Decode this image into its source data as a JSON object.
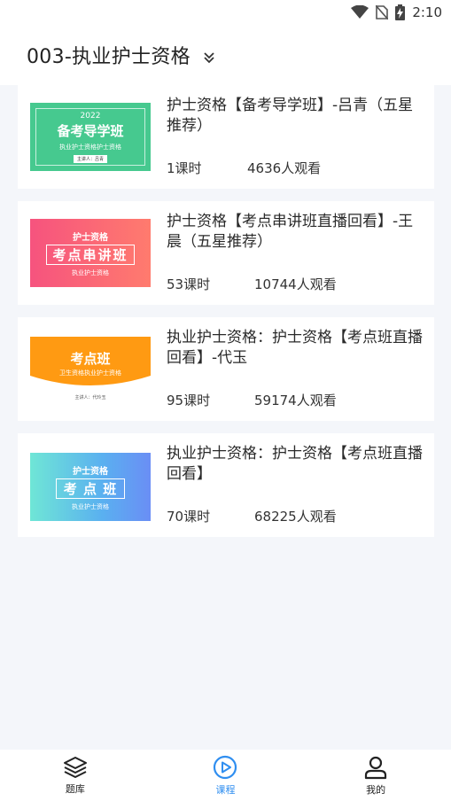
{
  "status": {
    "time": "2:10"
  },
  "header": {
    "title": "003-执业护士资格"
  },
  "courses": [
    {
      "title": "护士资格【备考导学班】-吕青（五星推荐）",
      "lessons": "1课时",
      "views": "4636人观看",
      "thumb": {
        "year": "2022",
        "main": "备考导学班",
        "sub": "执业护士资格护士资格",
        "lecturer": "主讲人：吕青"
      }
    },
    {
      "title": "护士资格【考点串讲班直播回看】-王晨（五星推荐）",
      "lessons": "53课时",
      "views": "10744人观看",
      "thumb": {
        "top": "护士资格",
        "main": "考点串讲班",
        "sub": "执业护士资格"
      }
    },
    {
      "title": "执业护士资格：护士资格【考点班直播回看】-代玉",
      "lessons": "95课时",
      "views": "59174人观看",
      "thumb": {
        "main": "考点班",
        "sub": "卫生资格执业护士资格",
        "lecturer": "主讲人：代玲玉"
      }
    },
    {
      "title": "执业护士资格：护士资格【考点班直播回看】",
      "lessons": "70课时",
      "views": "68225人观看",
      "thumb": {
        "top": "护士资格",
        "main": "考 点 班",
        "sub": "执业护士资格"
      }
    }
  ],
  "tabs": [
    {
      "label": "题库",
      "icon": "layers-icon"
    },
    {
      "label": "课程",
      "icon": "play-circle-icon",
      "active": true
    },
    {
      "label": "我的",
      "icon": "person-icon"
    }
  ],
  "colors": {
    "accent": "#2f8ef0"
  }
}
